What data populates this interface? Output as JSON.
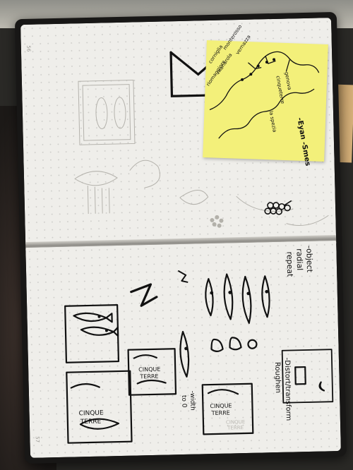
{
  "page_numbers": {
    "top": "56",
    "bottom": "57"
  },
  "map_labels": {
    "place_1": "monterosso",
    "place_2": "vernazza",
    "place_3": "corniglia",
    "place_4": "manarola",
    "place_5": "riomaggiore",
    "region_1": "genova",
    "region_2": "cinqueterre",
    "region_3": "la spezia",
    "sticky_caption": "-Eyan -Smes"
  },
  "notes": {
    "object_line1": "-object",
    "object_line2": "radial",
    "object_line3": "repeat",
    "distort_line1": "-Distort/transform",
    "distort_line2": "Roughen",
    "width_line1": "-width",
    "width_line2": "to 0"
  },
  "sketch_text": {
    "cinque_terre_1": "CINQUE",
    "cinque_terre_1b": "TERRE",
    "cinque_terre_2": "CINQUE",
    "cinque_terre_2b": "TERRE",
    "cinque_terre_3": "CINQUE",
    "cinque_terre_3b": "TERRE",
    "cinque_terre_4": "CINQUE",
    "cinque_terre_4b": "TERRE"
  }
}
